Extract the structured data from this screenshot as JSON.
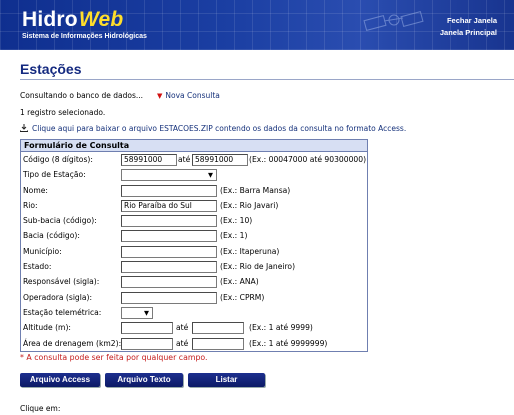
{
  "header": {
    "logo_hidro": "Hidro",
    "logo_web": "Web",
    "subtitle": "Sistema de Informações Hidrológicas",
    "links": [
      "Fechar Janela",
      "Janela Principal"
    ]
  },
  "page": {
    "title": "Estações",
    "status": "Consultando o banco de dados...",
    "nova_consulta": "Nova Consulta",
    "registros": "1 registro selecionado.",
    "download": "Clique aqui para baixar o arquivo ESTACOES.ZIP contendo os dados da consulta no formato Access."
  },
  "form": {
    "heading": "Formulário de Consulta",
    "and_word": "até",
    "fields": {
      "codigo": {
        "label": "Código (8 dígitos):",
        "value_from": "58991000",
        "value_to": "58991000",
        "example": "(Ex.: 00047000 até 90300000)"
      },
      "tipo": {
        "label": "Tipo de Estação:",
        "value": ""
      },
      "nome": {
        "label": "Nome:",
        "value": "",
        "example": "(Ex.: Barra Mansa)"
      },
      "rio": {
        "label": "Rio:",
        "value": "Rio Paraíba do Sul",
        "example": "(Ex.: Rio Javari)"
      },
      "subbacia": {
        "label": "Sub-bacia (código):",
        "value": "",
        "example": "(Ex.: 10)"
      },
      "bacia": {
        "label": "Bacia (código):",
        "value": "",
        "example": "(Ex.: 1)"
      },
      "municipio": {
        "label": "Município:",
        "value": "",
        "example": "(Ex.: Itaperuna)"
      },
      "estado": {
        "label": "Estado:",
        "value": "",
        "example": "(Ex.: Rio de Janeiro)"
      },
      "responsavel": {
        "label": "Responsável (sigla):",
        "value": "",
        "example": "(Ex.: ANA)"
      },
      "operadora": {
        "label": "Operadora (sigla):",
        "value": "",
        "example": "(Ex.: CPRM)"
      },
      "telemetrica": {
        "label": "Estação telemétrica:",
        "value": ""
      },
      "altitude": {
        "label": "Altitude (m):",
        "value_from": "",
        "value_to": "",
        "example": "(Ex.: 1 até 9999)"
      },
      "drenagem": {
        "label": "Área de drenagem (km2):",
        "value_from": "",
        "value_to": "",
        "example": "(Ex.: 1 até 9999999)"
      }
    },
    "note": "* A consulta pode ser feita por qualquer campo."
  },
  "buttons": {
    "access": "Arquivo Access",
    "texto": "Arquivo Texto",
    "listar": "Listar"
  },
  "footer": {
    "clique": "Clique em:"
  }
}
